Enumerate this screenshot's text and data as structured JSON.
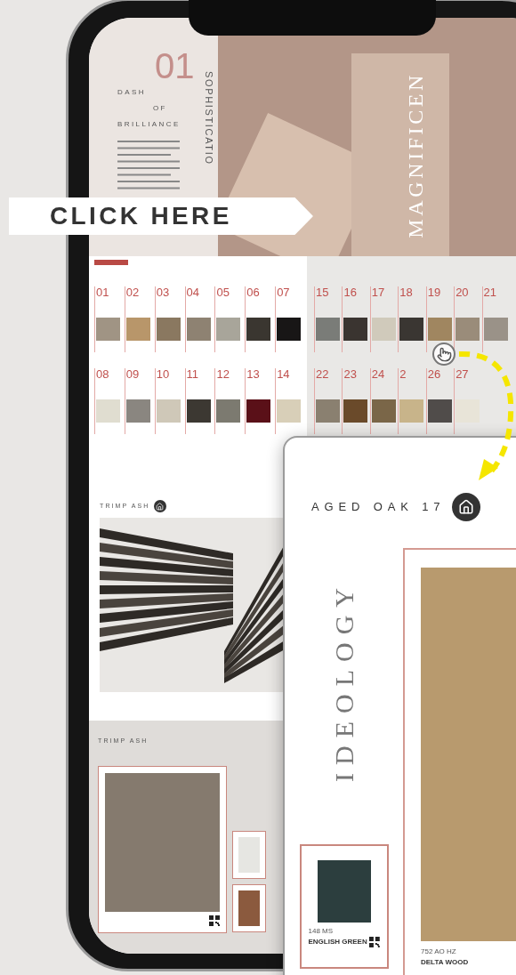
{
  "banner": {
    "label": "CLICK HERE"
  },
  "hero": {
    "number": "01",
    "title_lines": [
      "DASH",
      "OF",
      "BRILLIANCE"
    ],
    "vertical_label": "SOPHISTICATIO",
    "photo_title": "MAGNIFICEN"
  },
  "contents_left": [
    {
      "number": "01",
      "color": "#a09484"
    },
    {
      "number": "02",
      "color": "#b8966a"
    },
    {
      "number": "03",
      "color": "#8a7860"
    },
    {
      "number": "04",
      "color": "#8e8272"
    },
    {
      "number": "05",
      "color": "#a8a59a"
    },
    {
      "number": "06",
      "color": "#3a3630"
    },
    {
      "number": "07",
      "color": "#181616"
    },
    {
      "number": "08",
      "color": "#e0ddd0"
    },
    {
      "number": "09",
      "color": "#8a8680"
    },
    {
      "number": "10",
      "color": "#cfc8b8"
    },
    {
      "number": "11",
      "color": "#3c3832"
    },
    {
      "number": "12",
      "color": "#7c7a70"
    },
    {
      "number": "13",
      "color": "#5a1018"
    },
    {
      "number": "14",
      "color": "#d8cfb8"
    }
  ],
  "contents_right": [
    {
      "number": "15",
      "color": "#7a7c78"
    },
    {
      "number": "16",
      "color": "#3a3430"
    },
    {
      "number": "17",
      "color": "#d0cabb"
    },
    {
      "number": "18",
      "color": "#3a3632"
    },
    {
      "number": "19",
      "color": "#a08660"
    },
    {
      "number": "20",
      "color": "#9a8c7a"
    },
    {
      "number": "21",
      "color": "#9a9288"
    },
    {
      "number": "22",
      "color": "#8a8070"
    },
    {
      "number": "23",
      "color": "#6a4a2a"
    },
    {
      "number": "24",
      "color": "#7a6648"
    },
    {
      "number": "2",
      "color": "#c8b48a"
    },
    {
      "number": "26",
      "color": "#504c4a"
    },
    {
      "number": "27",
      "color": "#e8e4d8"
    }
  ],
  "page_one": {
    "title": "TRIMP ASH"
  },
  "page_two": {
    "title": "TRIMP ASH"
  },
  "detail": {
    "title": "AGED OAK 17",
    "vertical_label": "IDEOLOGY",
    "samples": [
      {
        "code": "148 MS",
        "name": "ENGLISH GREEN",
        "color": "#2c3e3e"
      },
      {
        "code": "752 AO HZ",
        "name": "DELTA WOOD",
        "color": "#b89a6e"
      }
    ]
  }
}
